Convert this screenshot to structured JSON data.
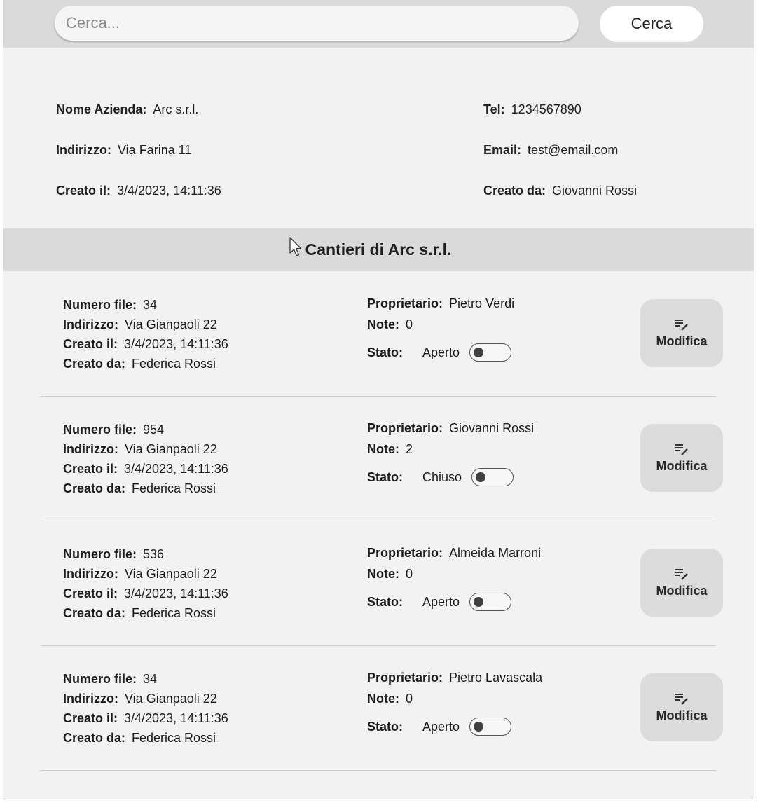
{
  "search": {
    "placeholder": "Cerca...",
    "button_label": "Cerca"
  },
  "company": {
    "name_label": "Nome Azienda:",
    "name_value": "Arc s.r.l.",
    "address_label": "Indirizzo:",
    "address_value": "Via Farina 11",
    "created_label": "Creato il:",
    "created_value": "3/4/2023, 14:11:36",
    "tel_label": "Tel:",
    "tel_value": "1234567890",
    "email_label": "Email:",
    "email_value": "test@email.com",
    "created_by_label": "Creato da:",
    "created_by_value": "Giovanni Rossi"
  },
  "section": {
    "title": "Cantieri di Arc s.r.l."
  },
  "labels": {
    "file_number": "Numero file:",
    "address": "Indirizzo:",
    "created": "Creato il:",
    "created_by": "Creato da:",
    "owner": "Proprietario:",
    "notes": "Note:",
    "status": "Stato:",
    "edit": "Modifica"
  },
  "sites": [
    {
      "file_number": "34",
      "address": "Via Gianpaoli 22",
      "created": "3/4/2023, 14:11:36",
      "created_by": "Federica Rossi",
      "owner": "Pietro Verdi",
      "notes": "0",
      "status": "Aperto"
    },
    {
      "file_number": "954",
      "address": "Via Gianpaoli 22",
      "created": "3/4/2023, 14:11:36",
      "created_by": "Federica Rossi",
      "owner": "Giovanni Rossi",
      "notes": "2",
      "status": "Chiuso"
    },
    {
      "file_number": "536",
      "address": "Via Gianpaoli 22",
      "created": "3/4/2023, 14:11:36",
      "created_by": "Federica Rossi",
      "owner": "Almeida Marroni",
      "notes": "0",
      "status": "Aperto"
    },
    {
      "file_number": "34",
      "address": "Via Gianpaoli 22",
      "created": "3/4/2023, 14:11:36",
      "created_by": "Federica Rossi",
      "owner": "Pietro Lavascala",
      "notes": "0",
      "status": "Aperto"
    }
  ],
  "icons": {
    "edit": "edit-note-icon",
    "cursor": "mouse-pointer-icon"
  },
  "colors": {
    "background": "#f2f2f2",
    "bar": "#dadada",
    "button": "#dcdcdc"
  }
}
